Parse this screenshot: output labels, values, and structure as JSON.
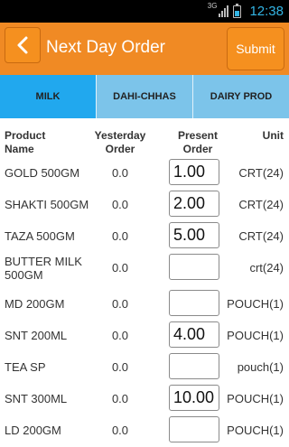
{
  "status_bar": {
    "network": "3G",
    "time": "12:38",
    "battery_level": 0.45
  },
  "app_bar": {
    "title": "Next Day Order",
    "submit_label": "Submit",
    "back_icon": "chevron-left-icon"
  },
  "tabs": [
    {
      "label": "MILK",
      "active": true
    },
    {
      "label": "DAHI-CHHAS",
      "active": false
    },
    {
      "label": "DAIRY PROD",
      "active": false
    }
  ],
  "table": {
    "headers": {
      "product": "Product Name",
      "yesterday": "Yesterday Order",
      "present": "Present Order",
      "unit": "Unit"
    },
    "rows": [
      {
        "name": "GOLD 500GM",
        "yesterday": "0.0",
        "present": "1.00",
        "unit": "CRT(24)"
      },
      {
        "name": "SHAKTI 500GM",
        "yesterday": "0.0",
        "present": "2.00",
        "unit": "CRT(24)"
      },
      {
        "name": "TAZA 500GM",
        "yesterday": "0.0",
        "present": "5.00",
        "unit": "CRT(24)"
      },
      {
        "name": "BUTTER MILK 500GM",
        "yesterday": "0.0",
        "present": "",
        "unit": "crt(24)"
      },
      {
        "name": "MD 200GM",
        "yesterday": "0.0",
        "present": "",
        "unit": "POUCH(1)"
      },
      {
        "name": "SNT 200ML",
        "yesterday": "0.0",
        "present": "4.00",
        "unit": "POUCH(1)"
      },
      {
        "name": "TEA SP",
        "yesterday": "0.0",
        "present": "",
        "unit": "pouch(1)"
      },
      {
        "name": "SNT 300ML",
        "yesterday": "0.0",
        "present": "10.00",
        "unit": "POUCH(1)"
      },
      {
        "name": "LD 200GM",
        "yesterday": "0.0",
        "present": "",
        "unit": "POUCH(1)"
      }
    ]
  },
  "colors": {
    "app_bar": "#f08a24",
    "tab_bar": "#7cc4ea",
    "tab_active": "#21a8ee",
    "clock": "#33b5e5"
  }
}
